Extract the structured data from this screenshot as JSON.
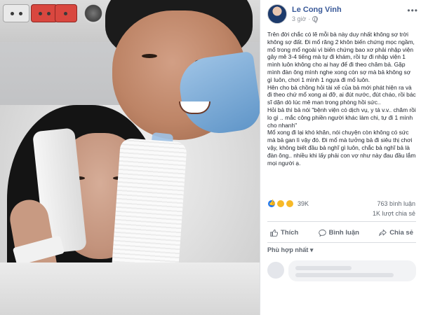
{
  "post": {
    "author": "Le Cong Vinh",
    "time": "3 giờ",
    "paragraphs": [
      "Trên đời chắc có lẽ mỗi bà này duy nhất không sợ trời không sợ đất. Đi mổ răng 2 khôn biến chứng mọc ngầm, mổ trong mổ ngoài vì biến chứng bao xơ phải nhập viện gây mê 3-4 tiếng mà tự đi khám, rồi tự đi nhập viện 1 mình luôn không cho ai hay để đi theo chăm bả. Gặp mình đàn ông mình nghe xong còn sợ mà bả không sợ gì luôn, chơi 1 mình 1 ngựa đi mổ luôn.",
      "Hên cho bả chồng hỏi tài xế của bả mới phát hiện ra và đi theo chứ mổ xong ai đỡ, ai đút nước, đút cháo, rồi bác sĩ dặn dò lúc mê man trong phòng hồi sức..",
      "Hỏi bả thì bả nói \"bệnh viện có dịch vụ, y tá v.v.. chăm rồi lo gì .. mắc công phiền người khác làm chi, tự đi 1 mình cho nhanh\"",
      "Mổ xong đi lại khó khăn, nói chuyện còn không có sức mà bả gan lì vậy đó. Đi mổ mà tưởng bả đi siêu thị chơi vậy, không biết đầu bả nghĩ gì luôn, chắc bả nghĩ bả là đàn ông.. nhiều khi lấy phải con vợ như này đau đầu lắm mọi người ạ."
    ],
    "reaction_count": "39K",
    "comments_count": "763 bình luận",
    "shares_count": "1K lượt chia sẻ",
    "actions": {
      "like": "Thích",
      "comment": "Bình luận",
      "share": "Chia sẻ"
    },
    "sort_label": "Phù hợp nhất ▾"
  },
  "colors": {
    "link": "#385898",
    "like_blue": "#2078f4",
    "text": "#1d2129",
    "muted": "#606770"
  },
  "icons": [
    "globe-icon",
    "more-icon",
    "like-icon",
    "comment-icon",
    "share-icon"
  ]
}
